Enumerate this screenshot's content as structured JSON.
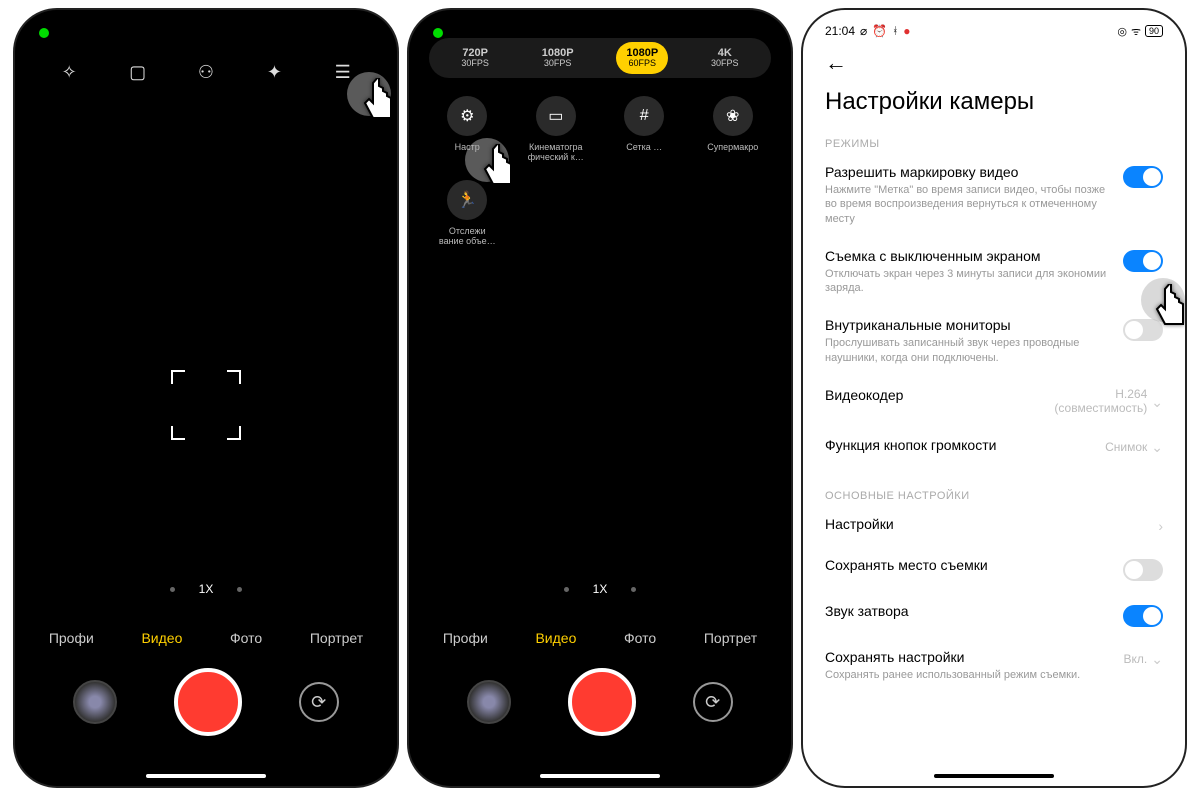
{
  "phone1": {
    "zoom_label": "1X",
    "modes": [
      "Профи",
      "Видео",
      "Фото",
      "Портрет"
    ],
    "active_mode_index": 1
  },
  "phone2": {
    "resolutions": [
      {
        "top": "720P",
        "bottom": "30FPS",
        "active": false
      },
      {
        "top": "1080P",
        "bottom": "30FPS",
        "active": false
      },
      {
        "top": "1080P",
        "bottom": "60FPS",
        "active": true
      },
      {
        "top": "4K",
        "bottom": "30FPS",
        "active": false
      }
    ],
    "tools": [
      {
        "label": "Настр"
      },
      {
        "label": "Кинематогра\nфический к…"
      },
      {
        "label": "Сетка …"
      },
      {
        "label": "Супермакро"
      },
      {
        "label": "Отслежи\nвание объе…"
      }
    ],
    "zoom_label": "1X",
    "modes": [
      "Профи",
      "Видео",
      "Фото",
      "Портрет"
    ],
    "active_mode_index": 1
  },
  "phone3": {
    "status_time": "21:04",
    "battery_label": "90",
    "page_title": "Настройки камеры",
    "section1": "РЕЖИМЫ",
    "section2": "ОСНОВНЫЕ НАСТРОЙКИ",
    "settings": {
      "video_mark": {
        "title": "Разрешить маркировку видео",
        "desc": "Нажмите \"Метка\" во время записи видео, чтобы позже во время воспроизведения вернуться к отмеченному месту",
        "on": true
      },
      "screen_off": {
        "title": "Съемка с выключенным экраном",
        "desc": "Отключать экран через 3 минуты записи для экономии заряда.",
        "on": true
      },
      "monitors": {
        "title": "Внутриканальные мониторы",
        "desc": "Прослушивать записанный звук через проводные наушники, когда они подключены.",
        "on": false
      },
      "encoder": {
        "title": "Видеокодер",
        "value": "H.264\n(совместимость)"
      },
      "volume": {
        "title": "Функция кнопок громкости",
        "value": "Снимок"
      },
      "settings": {
        "title": "Настройки"
      },
      "save_loc": {
        "title": "Сохранять место съемки",
        "on": false
      },
      "shutter_sound": {
        "title": "Звук затвора",
        "on": true
      },
      "save_settings": {
        "title": "Сохранять настройки",
        "desc": "Сохранять ранее использованный режим съемки.",
        "value": "Вкл."
      }
    }
  }
}
